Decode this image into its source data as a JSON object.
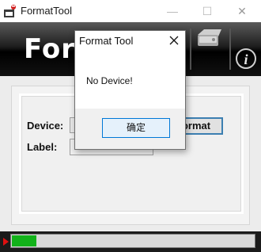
{
  "window": {
    "title": "FormatTool",
    "minimize_glyph": "—",
    "maximize_glyph": "☐",
    "close_glyph": "✕"
  },
  "banner": {
    "title_visible": "Forma",
    "info_glyph": "i",
    "icons": [
      "hard-disk-icon",
      "info-icon"
    ]
  },
  "form": {
    "device_label": "Device:",
    "device_value": "",
    "label_label": "Label:",
    "label_value": "",
    "format_button_visible": "ormat"
  },
  "status": {
    "progress_fraction": 0.1
  },
  "dialog": {
    "title": "Format Tool",
    "message": "No Device!",
    "ok_label": "确定"
  },
  "colors": {
    "progress_fill": "#12b21a",
    "accent": "#0078d7",
    "play_marker": "#e01010"
  }
}
